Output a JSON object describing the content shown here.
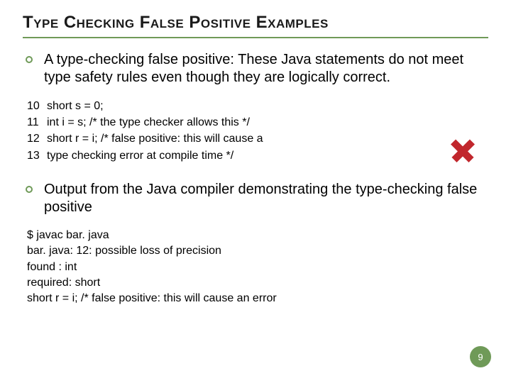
{
  "title": "Type Checking False Positive Examples",
  "bullets": [
    "A type-checking false positive: These Java statements do not meet type safety rules even though they are logically correct.",
    "Output from the Java compiler demonstrating the type-checking false positive"
  ],
  "code": [
    {
      "n": "10",
      "t": "short s = 0;"
    },
    {
      "n": "11",
      "t": "int i = s;   /* the type checker allows this */"
    },
    {
      "n": "12",
      "t": "short r = i; /* false positive: this will cause a"
    },
    {
      "n": "13",
      "t": "                  type checking error at compile time */"
    }
  ],
  "output": [
    "$ javac bar. java",
    "bar. java: 12: possible loss of precision",
    "found    : int",
    "required: short",
    "short r = i; /* false positive: this will cause an error"
  ],
  "cross_color": "#c1272d",
  "page_number": "9"
}
